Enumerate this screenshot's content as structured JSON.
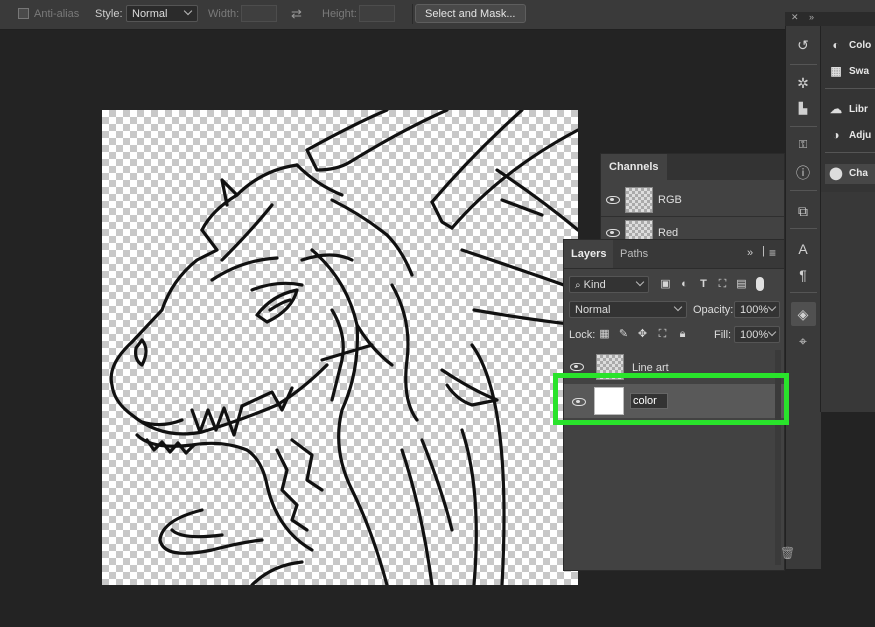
{
  "options_bar": {
    "anti_alias_label": "Anti-alias",
    "style_label": "Style:",
    "style_value": "Normal",
    "width_label": "Width:",
    "height_label": "Height:",
    "select_and_mask_label": "Select and Mask..."
  },
  "side_panels": {
    "items": [
      "Colo",
      "Swa",
      "Libr",
      "Adju",
      "Cha"
    ]
  },
  "channels_panel": {
    "tab_label": "Channels",
    "rows": [
      {
        "name": "RGB"
      },
      {
        "name": "Red"
      }
    ]
  },
  "layers_panel": {
    "tabs": [
      "Layers",
      "Paths"
    ],
    "filter_kind": "Kind",
    "blend_mode": "Normal",
    "opacity_label": "Opacity:",
    "opacity_value": "100%",
    "lock_label": "Lock:",
    "fill_label": "Fill:",
    "fill_value": "100%",
    "layers": [
      {
        "name": "Line art"
      },
      {
        "name": "color"
      }
    ]
  },
  "colors": {
    "highlight": "#29e32b",
    "panel_bg": "#424242",
    "app_bg": "#232323"
  }
}
